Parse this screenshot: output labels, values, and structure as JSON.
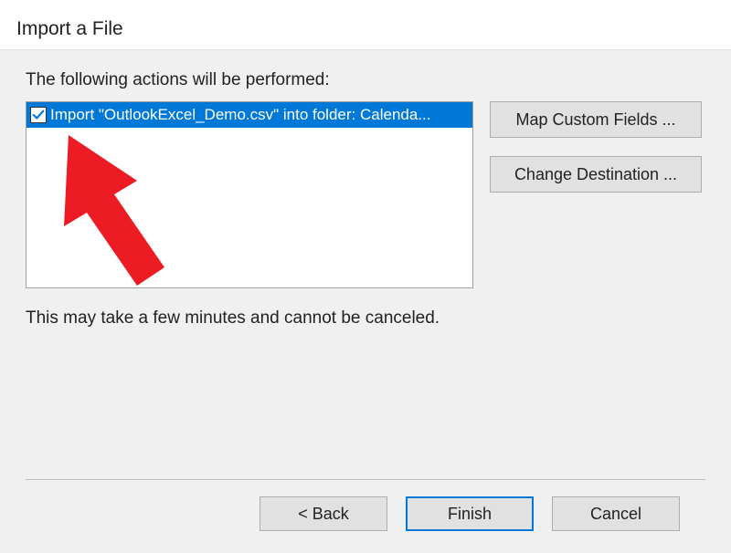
{
  "window": {
    "title": "Import a File"
  },
  "main": {
    "instruction": "The following actions will be performed:",
    "action_item": {
      "checked": true,
      "label": "Import \"OutlookExcel_Demo.csv\" into folder: Calenda..."
    },
    "note": "This may take a few minutes and cannot be canceled."
  },
  "side_buttons": {
    "map_fields": "Map Custom Fields ...",
    "change_dest": "Change Destination ..."
  },
  "footer": {
    "back": "<  Back",
    "finish": "Finish",
    "cancel": "Cancel"
  },
  "colors": {
    "selection": "#0078d7",
    "arrow": "#ed1c24"
  }
}
